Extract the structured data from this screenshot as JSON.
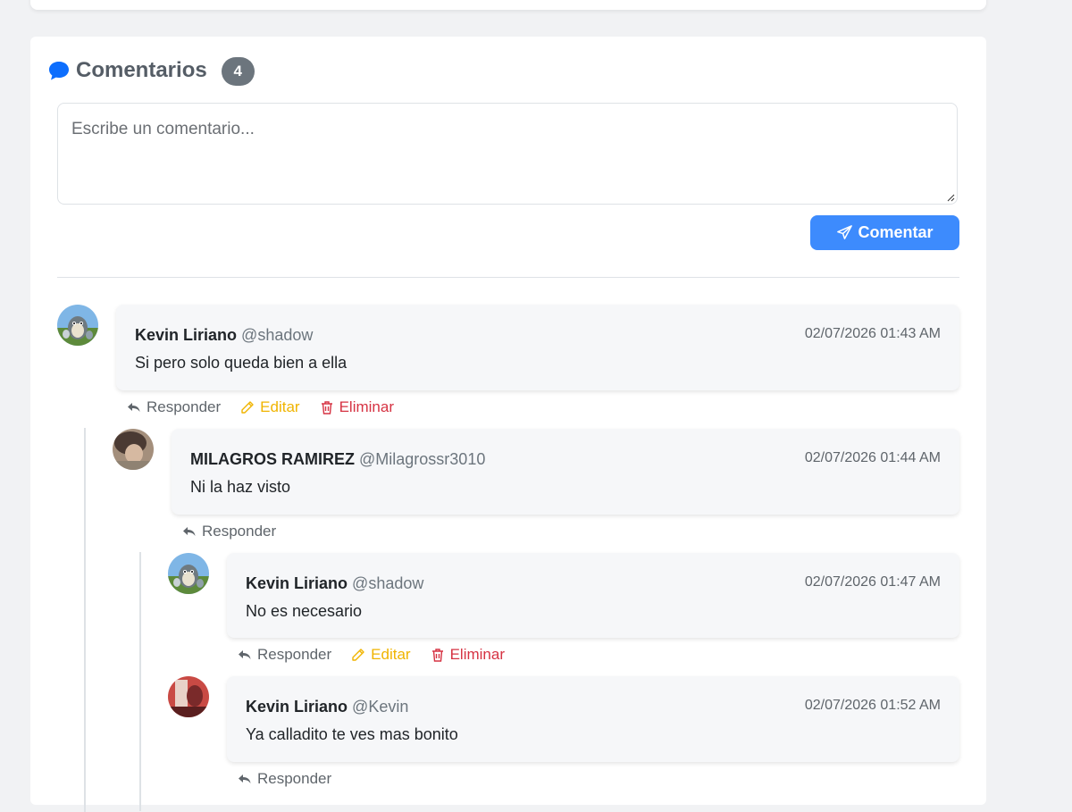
{
  "comments_section": {
    "title": "Comentarios",
    "count": "4",
    "input_placeholder": "Escribe un comentario...",
    "submit_label": "Comentar"
  },
  "actions": {
    "reply": "Responder",
    "edit": "Editar",
    "delete": "Eliminar"
  },
  "comments": [
    {
      "name": "Kevin Liriano",
      "handle": "@shadow",
      "date": "02/07/2026 01:43 AM",
      "text": "Si pero solo queda bien a ella"
    },
    {
      "name": "MILAGROS RAMIREZ",
      "handle": "@Milagrossr3010",
      "date": "02/07/2026 01:44 AM",
      "text": "Ni la haz visto"
    },
    {
      "name": "Kevin Liriano",
      "handle": "@shadow",
      "date": "02/07/2026 01:47 AM",
      "text": "No es necesario"
    },
    {
      "name": "Kevin Liriano",
      "handle": "@Kevin",
      "date": "02/07/2026 01:52 AM",
      "text": "Ya calladito te ves mas bonito"
    }
  ],
  "colors": {
    "primary": "#3d8bfd",
    "edit": "#f0b400",
    "delete": "#d63343",
    "badge": "#6c757d"
  },
  "icons": [
    "chat-bubble-icon",
    "send-icon",
    "reply-icon",
    "pencil-icon",
    "trash-icon"
  ]
}
